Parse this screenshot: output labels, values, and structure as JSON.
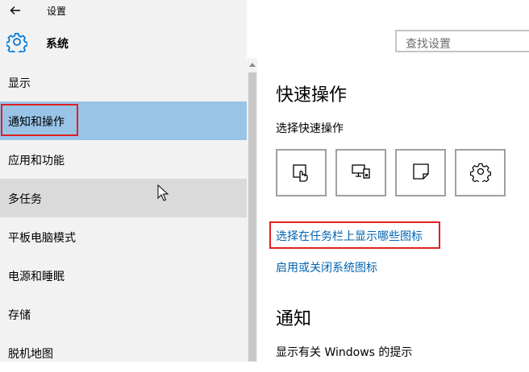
{
  "titlebar": {
    "back_icon": "arrow-left-icon",
    "title": "设置"
  },
  "header": {
    "icon": "gear-icon",
    "title": "系统"
  },
  "search": {
    "placeholder": "查找设置"
  },
  "sidebar": {
    "items": [
      {
        "label": "显示"
      },
      {
        "label": "通知和操作",
        "selected": true
      },
      {
        "label": "应用和功能"
      },
      {
        "label": "多任务",
        "hover": true
      },
      {
        "label": "平板电脑模式"
      },
      {
        "label": "电源和睡眠"
      },
      {
        "label": "存储"
      },
      {
        "label": "脱机地图"
      }
    ]
  },
  "main": {
    "quick_actions": {
      "heading": "快速操作",
      "subtitle": "选择快速操作",
      "tiles": [
        {
          "icon": "tablet-mode-icon"
        },
        {
          "icon": "project-display-icon"
        },
        {
          "icon": "note-icon"
        },
        {
          "icon": "settings-gear-icon"
        }
      ],
      "link_taskbar_icons": "选择在任务栏上显示哪些图标",
      "link_system_icons": "启用或关闭系统图标"
    },
    "notifications": {
      "heading": "通知",
      "subtitle": "显示有关 Windows 的提示"
    }
  },
  "colors": {
    "accent_link": "#0063b1",
    "selected_bg": "#99c4e8",
    "hover_bg": "#dadada",
    "highlight_box": "#e02020"
  }
}
